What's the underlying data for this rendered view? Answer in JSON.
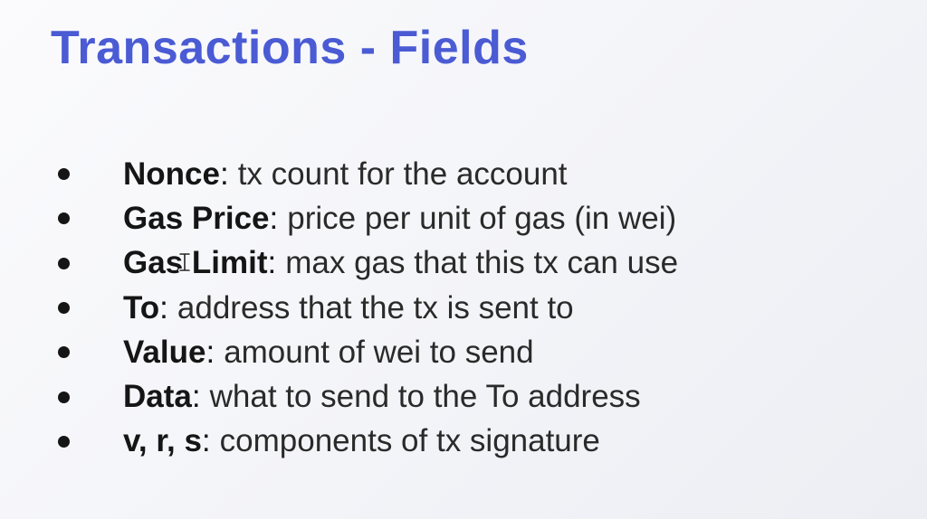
{
  "slide": {
    "title": "Transactions - Fields",
    "title_color": "#4a5bd4",
    "text_color": "#151515",
    "bullets": [
      {
        "term": "Nonce",
        "desc": "tx count for the account"
      },
      {
        "term": "Gas Price",
        "desc": "price per unit of gas (in wei)"
      },
      {
        "term": "Gas Limit",
        "desc": "max gas that this tx can use"
      },
      {
        "term": "To",
        "desc": "address that the tx is sent to"
      },
      {
        "term": "Value",
        "desc": "amount of wei to send"
      },
      {
        "term": "Data",
        "desc": "what to send to the To address"
      },
      {
        "term": "v, r, s",
        "desc": "components of tx signature"
      }
    ],
    "separator": ":",
    "cursor_icon": "text-cursor-icon"
  }
}
